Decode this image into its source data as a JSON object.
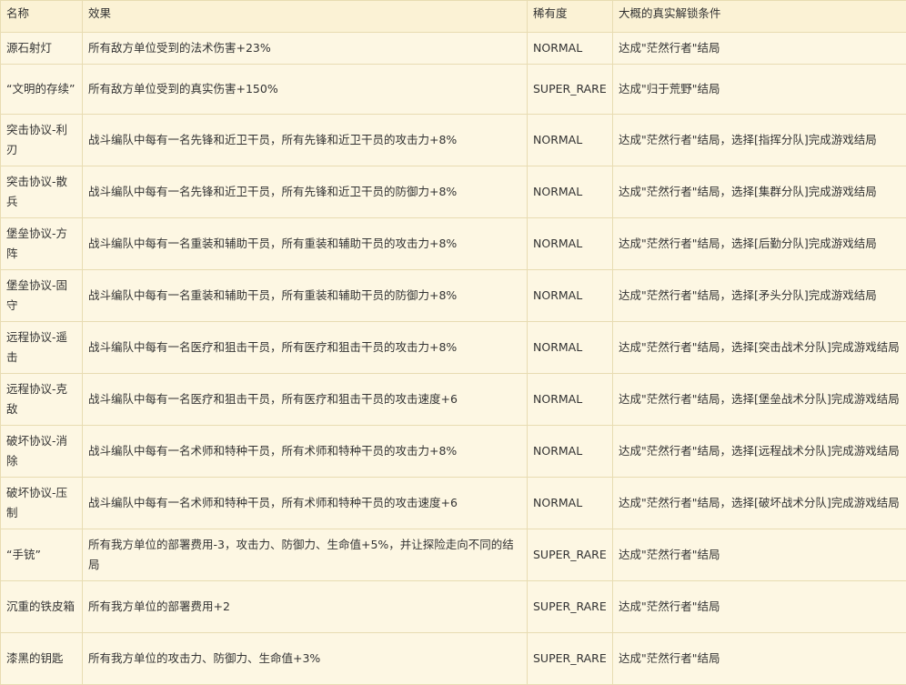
{
  "table": {
    "headers": [
      "名称",
      "效果",
      "稀有度",
      "大概的真实解锁条件"
    ],
    "rows": [
      {
        "name": "源石射灯",
        "effect": "所有敌方单位受到的法术伤害+23%",
        "rarity": "NORMAL",
        "unlock": "达成\"茫然行者\"结局"
      },
      {
        "name": "“文明的存续”",
        "effect": "所有敌方单位受到的真实伤害+150%",
        "rarity": "SUPER_RARE",
        "unlock": "达成\"归于荒野\"结局"
      },
      {
        "name": "突击协议-利刃",
        "effect": "战斗编队中每有一名先锋和近卫干员，所有先锋和近卫干员的攻击力+8%",
        "rarity": "NORMAL",
        "unlock": "达成\"茫然行者\"结局，选择[指挥分队]完成游戏结局"
      },
      {
        "name": "突击协议-散兵",
        "effect": "战斗编队中每有一名先锋和近卫干员，所有先锋和近卫干员的防御力+8%",
        "rarity": "NORMAL",
        "unlock": "达成\"茫然行者\"结局，选择[集群分队]完成游戏结局"
      },
      {
        "name": "堡垒协议-方阵",
        "effect": "战斗编队中每有一名重装和辅助干员，所有重装和辅助干员的攻击力+8%",
        "rarity": "NORMAL",
        "unlock": "达成\"茫然行者\"结局，选择[后勤分队]完成游戏结局"
      },
      {
        "name": "堡垒协议-固守",
        "effect": "战斗编队中每有一名重装和辅助干员，所有重装和辅助干员的防御力+8%",
        "rarity": "NORMAL",
        "unlock": "达成\"茫然行者\"结局，选择[矛头分队]完成游戏结局"
      },
      {
        "name": "远程协议-遥击",
        "effect": "战斗编队中每有一名医疗和狙击干员，所有医疗和狙击干员的攻击力+8%",
        "rarity": "NORMAL",
        "unlock": "达成\"茫然行者\"结局，选择[突击战术分队]完成游戏结局"
      },
      {
        "name": "远程协议-克敌",
        "effect": "战斗编队中每有一名医疗和狙击干员，所有医疗和狙击干员的攻击速度+6",
        "rarity": "NORMAL",
        "unlock": "达成\"茫然行者\"结局，选择[堡垒战术分队]完成游戏结局"
      },
      {
        "name": "破坏协议-消除",
        "effect": "战斗编队中每有一名术师和特种干员，所有术师和特种干员的攻击力+8%",
        "rarity": "NORMAL",
        "unlock": "达成\"茫然行者\"结局，选择[远程战术分队]完成游戏结局"
      },
      {
        "name": "破坏协议-压制",
        "effect": "战斗编队中每有一名术师和特种干员，所有术师和特种干员的攻击速度+6",
        "rarity": "NORMAL",
        "unlock": "达成\"茫然行者\"结局，选择[破坏战术分队]完成游戏结局"
      },
      {
        "name": "“手铳”",
        "effect": "所有我方单位的部署费用-3，攻击力、防御力、生命值+5%，并让探险走向不同的结局",
        "rarity": "SUPER_RARE",
        "unlock": "达成\"茫然行者\"结局"
      },
      {
        "name": "沉重的铁皮箱",
        "effect": "所有我方单位的部署费用+2",
        "rarity": "SUPER_RARE",
        "unlock": "达成\"茫然行者\"结局"
      },
      {
        "name": "漆黑的钥匙",
        "effect": "所有我方单位的攻击力、防御力、生命值+3%",
        "rarity": "SUPER_RARE",
        "unlock": "达成\"茫然行者\"结局"
      }
    ]
  }
}
